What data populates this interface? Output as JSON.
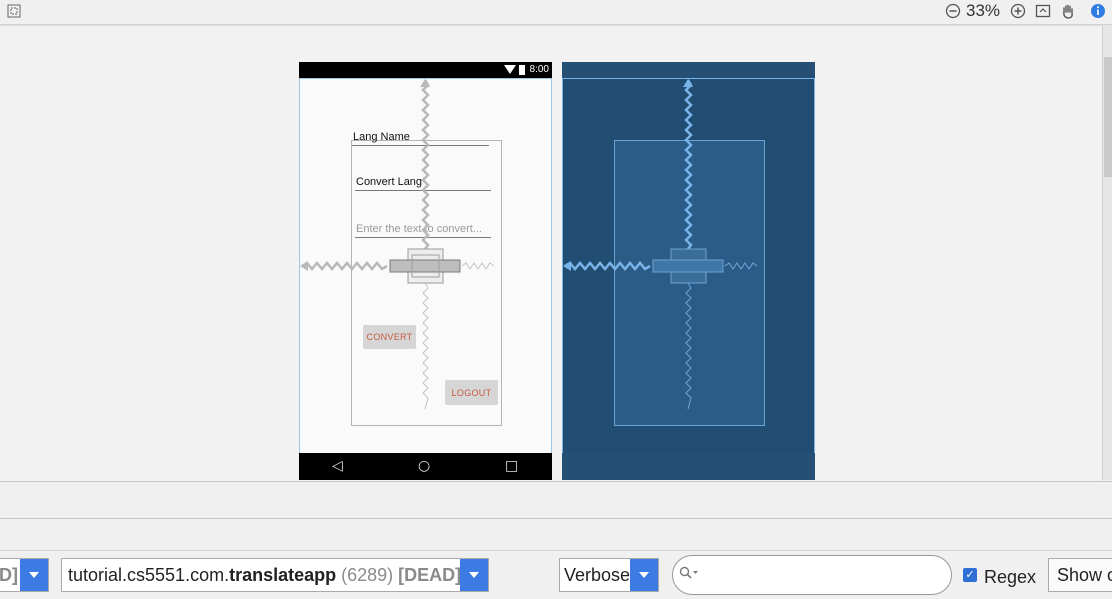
{
  "toolbar": {
    "zoom_level": "33%",
    "icons": [
      "fit-screen-icon",
      "zoom-out-icon",
      "zoom-in-icon",
      "zoom-actual-icon",
      "pan-hand-icon",
      "info-icon"
    ]
  },
  "device": {
    "status_time": "8:00",
    "fields": {
      "lang_name": "Lang Name",
      "convert_lang": "Convert Lang",
      "text_hint": "Enter the text to convert..."
    },
    "buttons": {
      "convert": "CONVERT",
      "logout": "LOGOUT"
    },
    "nav": {
      "back": "◁",
      "home": "○",
      "recents": "□"
    }
  },
  "logcat": {
    "device_combo_fragment": "D]",
    "process_prefix": "tutorial.cs5551.com.",
    "process_name": "translateapp",
    "process_pid": " (6289) ",
    "process_state": "[DEAD]",
    "log_level": "Verbose",
    "search_value": "",
    "regex_label": "Regex",
    "regex_checked": true,
    "show_button": "Show o"
  },
  "colors": {
    "accent": "#3c7ae4",
    "blueprint_bg": "#224d72",
    "button_text": "#c65a3d"
  }
}
